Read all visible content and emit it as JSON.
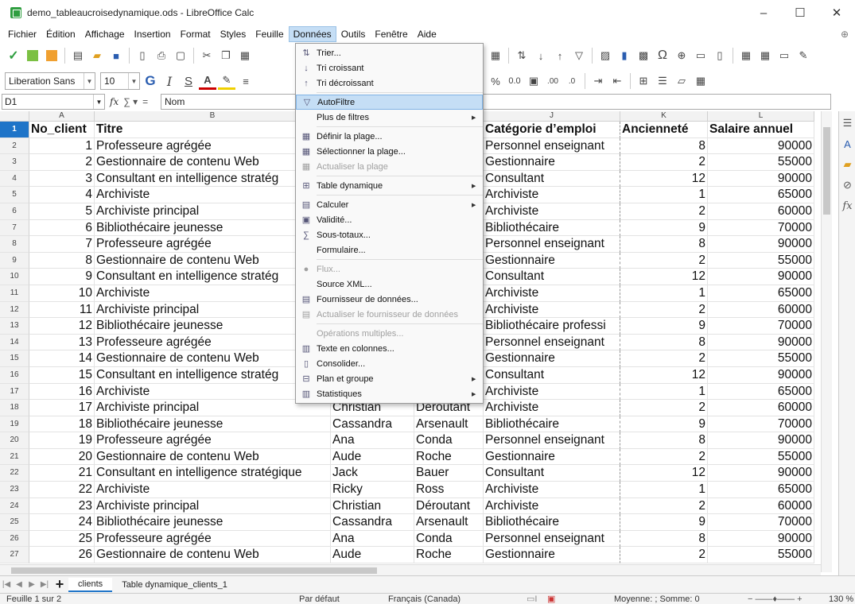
{
  "window": {
    "title": "demo_tableaucroisedynamique.ods - LibreOffice Calc",
    "controls": [
      "–",
      "☐",
      "✕"
    ]
  },
  "menubar": {
    "items": [
      "Fichier",
      "Édition",
      "Affichage",
      "Insertion",
      "Format",
      "Styles",
      "Feuille",
      "Données",
      "Outils",
      "Fenêtre",
      "Aide"
    ],
    "active_index": 7
  },
  "toolbar": {
    "font_name": "Liberation Sans",
    "font_size": "10"
  },
  "formula_bar": {
    "name_box": "D1",
    "content": "Nom"
  },
  "grid": {
    "column_letters": [
      "A",
      "B",
      "",
      "",
      "J",
      "K",
      "L"
    ],
    "row_numbers": [
      "1",
      "2",
      "3",
      "4",
      "5",
      "6",
      "7",
      "8",
      "9",
      "10",
      "11",
      "12",
      "13",
      "14",
      "15",
      "16",
      "17",
      "18",
      "19",
      "20",
      "21",
      "22",
      "23",
      "24",
      "25",
      "26",
      "27"
    ],
    "headers": {
      "a": "No_client",
      "b": "Titre",
      "j": "Catégorie d’emploi",
      "k": "Ancienneté",
      "l": "Salaire annuel"
    },
    "rows": [
      {
        "a": "1",
        "b": "Professeure agrégée",
        "h": "",
        "i": "",
        "j": "Personnel enseignant",
        "k": "8",
        "l": "90000"
      },
      {
        "a": "2",
        "b": "Gestionnaire de contenu Web",
        "h": "",
        "i": "",
        "j": "Gestionnaire",
        "k": "2",
        "l": "55000"
      },
      {
        "a": "3",
        "b": "Consultant en intelligence stratég",
        "h": "",
        "i": "",
        "j": "Consultant",
        "k": "12",
        "l": "90000"
      },
      {
        "a": "4",
        "b": "Archiviste",
        "h": "",
        "i": "",
        "j": "Archiviste",
        "k": "1",
        "l": "65000"
      },
      {
        "a": "5",
        "b": "Archiviste principal",
        "h": "",
        "i": "",
        "j": "Archiviste",
        "k": "2",
        "l": "60000"
      },
      {
        "a": "6",
        "b": "Bibliothécaire jeunesse",
        "h": "",
        "i": "",
        "j": "Bibliothécaire",
        "k": "9",
        "l": "70000"
      },
      {
        "a": "7",
        "b": "Professeure agrégée",
        "h": "",
        "i": "",
        "j": "Personnel enseignant",
        "k": "8",
        "l": "90000"
      },
      {
        "a": "8",
        "b": "Gestionnaire de contenu Web",
        "h": "",
        "i": "",
        "j": "Gestionnaire",
        "k": "2",
        "l": "55000"
      },
      {
        "a": "9",
        "b": "Consultant en intelligence stratég",
        "h": "",
        "i": "",
        "j": "Consultant",
        "k": "12",
        "l": "90000"
      },
      {
        "a": "10",
        "b": "Archiviste",
        "h": "",
        "i": "",
        "j": "Archiviste",
        "k": "1",
        "l": "65000"
      },
      {
        "a": "11",
        "b": "Archiviste principal",
        "h": "",
        "i": "",
        "j": "Archiviste",
        "k": "2",
        "l": "60000"
      },
      {
        "a": "12",
        "b": "Bibliothécaire jeunesse",
        "h": "",
        "i": "",
        "j": "Bibliothécaire professi",
        "k": "9",
        "l": "70000"
      },
      {
        "a": "13",
        "b": "Professeure agrégée",
        "h": "",
        "i": "",
        "j": "Personnel enseignant",
        "k": "8",
        "l": "90000"
      },
      {
        "a": "14",
        "b": "Gestionnaire de contenu Web",
        "h": "",
        "i": "",
        "j": "Gestionnaire",
        "k": "2",
        "l": "55000"
      },
      {
        "a": "15",
        "b": "Consultant en intelligence stratég",
        "h": "",
        "i": "",
        "j": "Consultant",
        "k": "12",
        "l": "90000"
      },
      {
        "a": "16",
        "b": "Archiviste",
        "h": "",
        "i": "",
        "j": "Archiviste",
        "k": "1",
        "l": "65000"
      },
      {
        "a": "17",
        "b": "Archiviste principal",
        "h": "Christian",
        "i": "Déroutant",
        "j": "Archiviste",
        "k": "2",
        "l": "60000"
      },
      {
        "a": "18",
        "b": "Bibliothécaire jeunesse",
        "h": "Cassandra",
        "i": "Arsenault",
        "j": "Bibliothécaire",
        "k": "9",
        "l": "70000"
      },
      {
        "a": "19",
        "b": "Professeure agrégée",
        "h": "Ana",
        "i": "Conda",
        "j": "Personnel enseignant",
        "k": "8",
        "l": "90000"
      },
      {
        "a": "20",
        "b": "Gestionnaire de contenu Web",
        "h": "Aude",
        "i": "Roche",
        "j": "Gestionnaire",
        "k": "2",
        "l": "55000"
      },
      {
        "a": "21",
        "b": "Consultant en intelligence stratégique",
        "h": "Jack",
        "i": "Bauer",
        "j": "Consultant",
        "k": "12",
        "l": "90000"
      },
      {
        "a": "22",
        "b": "Archiviste",
        "h": "Ricky",
        "i": "Ross",
        "j": "Archiviste",
        "k": "1",
        "l": "65000"
      },
      {
        "a": "23",
        "b": "Archiviste principal",
        "h": "Christian",
        "i": "Déroutant",
        "j": "Archiviste",
        "k": "2",
        "l": "60000"
      },
      {
        "a": "24",
        "b": "Bibliothécaire jeunesse",
        "h": "Cassandra",
        "i": "Arsenault",
        "j": "Bibliothécaire",
        "k": "9",
        "l": "70000"
      },
      {
        "a": "25",
        "b": "Professeure agrégée",
        "h": "Ana",
        "i": "Conda",
        "j": "Personnel enseignant",
        "k": "8",
        "l": "90000"
      },
      {
        "a": "26",
        "b": "Gestionnaire de contenu Web",
        "h": "Aude",
        "i": "Roche",
        "j": "Gestionnaire",
        "k": "2",
        "l": "55000"
      }
    ]
  },
  "dropdown": {
    "items": [
      {
        "label": "Trier...",
        "icon": "sort-icon",
        "glyph": "⇅",
        "disabled": false,
        "submenu": false
      },
      {
        "label": "Tri croissant",
        "icon": "sort-ascending-icon",
        "glyph": "↓",
        "disabled": false,
        "submenu": false
      },
      {
        "label": "Tri décroissant",
        "icon": "sort-descending-icon",
        "glyph": "↑",
        "disabled": false,
        "submenu": false,
        "sep_after": true
      },
      {
        "label": "AutoFiltre",
        "icon": "filter-icon",
        "glyph": "▽",
        "disabled": false,
        "submenu": false,
        "highlight": true
      },
      {
        "label": "Plus de filtres",
        "icon": "",
        "glyph": "",
        "disabled": false,
        "submenu": true,
        "sep_after": true
      },
      {
        "label": "Définir la plage...",
        "icon": "define-range-icon",
        "glyph": "▦",
        "disabled": false,
        "submenu": false
      },
      {
        "label": "Sélectionner la plage...",
        "icon": "select-range-icon",
        "glyph": "▦",
        "disabled": false,
        "submenu": false
      },
      {
        "label": "Actualiser la plage",
        "icon": "refresh-range-icon",
        "glyph": "▦",
        "disabled": true,
        "submenu": false,
        "sep_after": true
      },
      {
        "label": "Table dynamique",
        "icon": "pivot-table-icon",
        "glyph": "⊞",
        "disabled": false,
        "submenu": true,
        "sep_after": true
      },
      {
        "label": "Calculer",
        "icon": "calculate-icon",
        "glyph": "▤",
        "disabled": false,
        "submenu": true
      },
      {
        "label": "Validité...",
        "icon": "validity-icon",
        "glyph": "▣",
        "disabled": false,
        "submenu": false
      },
      {
        "label": "Sous-totaux...",
        "icon": "subtotals-icon",
        "glyph": "∑",
        "disabled": false,
        "submenu": false
      },
      {
        "label": "Formulaire...",
        "icon": "",
        "glyph": "",
        "disabled": false,
        "submenu": false,
        "sep_after": true
      },
      {
        "label": "Flux...",
        "icon": "stream-icon",
        "glyph": "●",
        "disabled": true,
        "submenu": false
      },
      {
        "label": "Source XML...",
        "icon": "",
        "glyph": "",
        "disabled": false,
        "submenu": false
      },
      {
        "label": "Fournisseur de données...",
        "icon": "data-provider-icon",
        "glyph": "▤",
        "disabled": false,
        "submenu": false
      },
      {
        "label": "Actualiser le fournisseur de données",
        "icon": "refresh-provider-icon",
        "glyph": "▤",
        "disabled": true,
        "submenu": false,
        "sep_after": true
      },
      {
        "label": "Opérations multiples...",
        "icon": "",
        "glyph": "",
        "disabled": true,
        "submenu": false
      },
      {
        "label": "Texte en colonnes...",
        "icon": "text-to-columns-icon",
        "glyph": "▥",
        "disabled": false,
        "submenu": false
      },
      {
        "label": "Consolider...",
        "icon": "consolidate-icon",
        "glyph": "▯",
        "disabled": false,
        "submenu": false
      },
      {
        "label": "Plan et groupe",
        "icon": "outline-icon",
        "glyph": "⊟",
        "disabled": false,
        "submenu": true
      },
      {
        "label": "Statistiques",
        "icon": "statistics-icon",
        "glyph": "▥",
        "disabled": false,
        "submenu": true
      }
    ]
  },
  "sheet_tabs": {
    "tabs": [
      "clients",
      "Table dynamique_clients_1"
    ],
    "active_index": 0
  },
  "status": {
    "sheet": "Feuille 1 sur 2",
    "page_style": "Par défaut",
    "language": "Français (Canada)",
    "summary": "Moyenne: ; Somme: 0",
    "zoom": "130 %"
  }
}
